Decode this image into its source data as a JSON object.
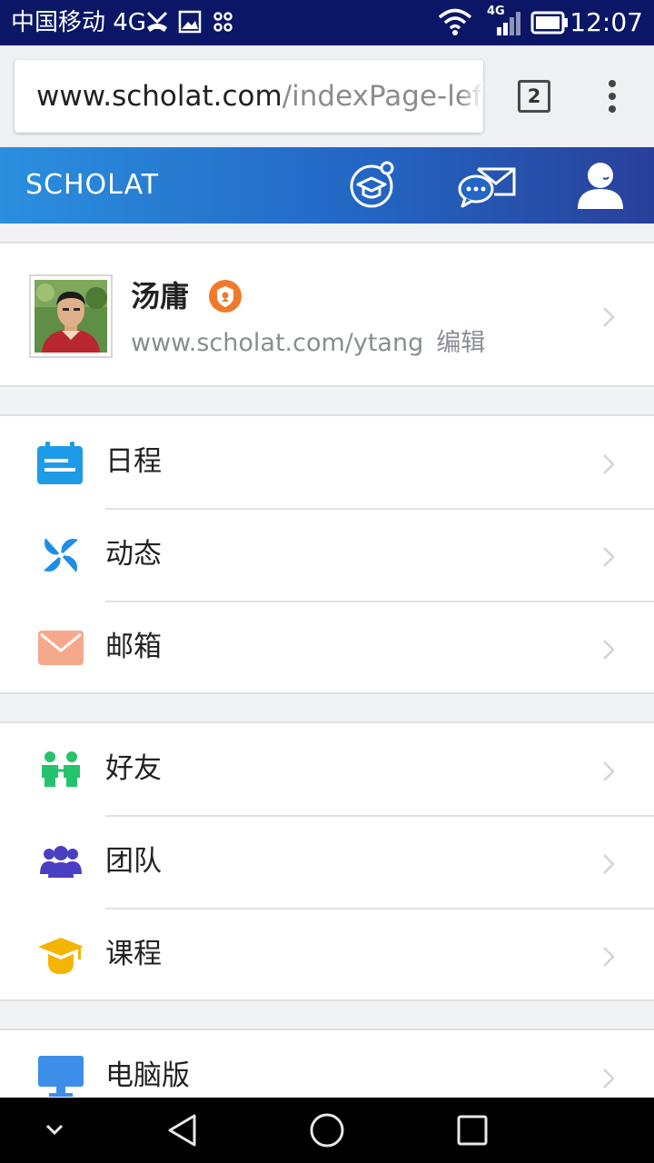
{
  "status_bar": {
    "carrier": "中国移动 4G",
    "network_badge": "4G",
    "time": "12:07",
    "icons": [
      "call-missed-icon",
      "image-icon",
      "voicemail-icon",
      "wifi-icon",
      "signal-icon",
      "battery-icon"
    ]
  },
  "browser": {
    "url_host": "www.scholat.com",
    "url_path": "/indexPage-left",
    "tab_count": "2",
    "menu_icon": "more-vert-icon"
  },
  "app_header": {
    "brand": "SCHOLAT",
    "icons": [
      "scholar-cap-icon",
      "messages-icon",
      "user-icon"
    ],
    "colors": {
      "start": "#2a8fde",
      "end": "#28409a"
    }
  },
  "profile": {
    "name": "汤庸",
    "url": "www.scholat.com/ytang",
    "edit_label": "编辑",
    "badge_color": "#f07a2c"
  },
  "menu": {
    "group1": [
      {
        "label": "日程",
        "icon": "calendar-icon",
        "color": "#1e9be8"
      },
      {
        "label": "动态",
        "icon": "pinwheel-icon",
        "color": "#1e8ee8"
      },
      {
        "label": "邮箱",
        "icon": "mail-icon",
        "color": "#f6a98a"
      }
    ],
    "group2": [
      {
        "label": "好友",
        "icon": "friends-icon",
        "color": "#27c26c"
      },
      {
        "label": "团队",
        "icon": "team-icon",
        "color": "#4a3fc2"
      },
      {
        "label": "课程",
        "icon": "graduation-cap-icon",
        "color": "#f4b400"
      }
    ],
    "group3": [
      {
        "label": "电脑版",
        "icon": "desktop-icon",
        "color": "#3d8ee8"
      }
    ]
  },
  "nav_bar": {
    "icons": [
      "collapse-icon",
      "back-icon",
      "home-icon",
      "recents-icon"
    ]
  }
}
